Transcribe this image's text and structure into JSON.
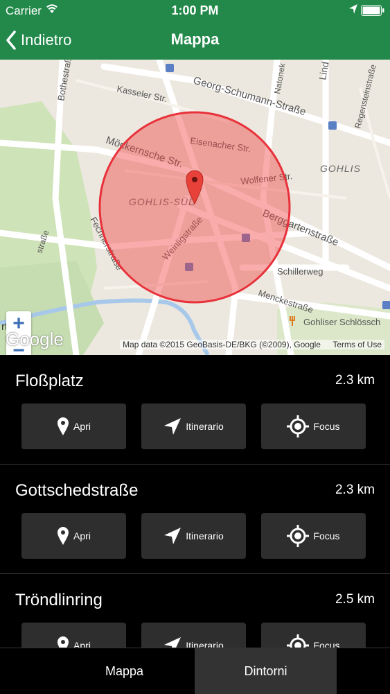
{
  "statusbar": {
    "carrier": "Carrier",
    "time": "1:00 PM"
  },
  "navbar": {
    "back_label": "Indietro",
    "title": "Mappa"
  },
  "map": {
    "labels": {
      "georg": "Georg-Schumann-Straße",
      "kasseler": "Kasseler Str.",
      "bothe": "Bothestraße",
      "mockern": "Möckernsche Str.",
      "eisenacher": "Eisenacher Str.",
      "wolfener": "Wolfener Str.",
      "gohlis": "GOHLIS",
      "gohlis_sud": "GOHLIS-SÜD",
      "berggarten": "Berggartenstraße",
      "weinlig": "Weinligstraße",
      "fechner": "Fechnerstraße",
      "schillerweg": "Schillerweg",
      "menckestr": "Menckestraße",
      "gohliser": "Gohliser Schlössch",
      "natonek": "Natonek",
      "lind": "Lind",
      "regensteiner": "Regensteinstraße",
      "strasse_left": "straße",
      "arthe": "rthe"
    },
    "zoom_in": "+",
    "zoom_out": "−",
    "google": "Google",
    "attribution": "Map data ©2015 GeoBasis-DE/BKG (©2009), Google",
    "terms": "Terms of Use"
  },
  "actions": {
    "open": "Apri",
    "route": "Itinerario",
    "focus": "Focus"
  },
  "results": [
    {
      "name": "Floßplatz",
      "distance": "2.3 km"
    },
    {
      "name": "Gottschedstraße",
      "distance": "2.3 km"
    },
    {
      "name": "Tröndlinring",
      "distance": "2.5 km"
    }
  ],
  "tabs": {
    "map": "Mappa",
    "nearby": "Dintorni"
  }
}
